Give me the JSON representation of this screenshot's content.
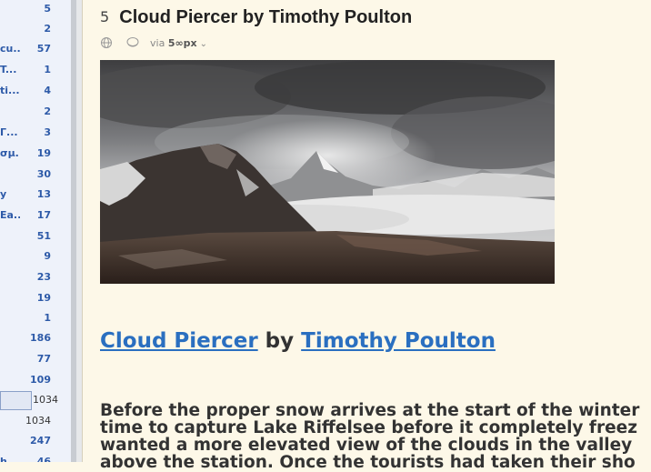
{
  "sidebar": {
    "feeds": [
      {
        "name": "",
        "count": "5"
      },
      {
        "name": "",
        "count": "2"
      },
      {
        "name": "cu...",
        "count": "57"
      },
      {
        "name": " T...",
        "count": "1"
      },
      {
        "name": "ti...",
        "count": "4"
      },
      {
        "name": "",
        "count": "2"
      },
      {
        "name": " Γ...",
        "count": "3"
      },
      {
        "name": "σμ...",
        "count": "19"
      },
      {
        "name": "",
        "count": "30"
      },
      {
        "name": "y",
        "count": "13"
      },
      {
        "name": "Ea...",
        "count": "17"
      },
      {
        "name": "",
        "count": "51"
      },
      {
        "name": "",
        "count": "9"
      },
      {
        "name": "",
        "count": "23"
      },
      {
        "name": "",
        "count": "19"
      },
      {
        "name": "",
        "count": "1"
      },
      {
        "name": "",
        "count": "186"
      },
      {
        "name": "",
        "count": "77"
      },
      {
        "name": "",
        "count": "109"
      },
      {
        "name": "",
        "count": "1034"
      },
      {
        "name": "",
        "count": "1034"
      },
      {
        "name": "",
        "count": "247"
      },
      {
        "name": "h",
        "count": "46"
      }
    ]
  },
  "story": {
    "feed_icon": "5",
    "title": "Cloud Piercer by Timothy Poulton",
    "via_label": "via",
    "source": "5∞px",
    "content_link_title": "Cloud Piercer",
    "content_by": " by ",
    "content_link_author": "Timothy Poulton",
    "body_lines": [
      "Before the proper snow arrives at the start of the winter",
      "time to capture Lake Riffelsee before it completely freez",
      "wanted a more elevated view of the clouds in the valley",
      "above the station. Once the tourists had taken their sho"
    ]
  },
  "icons": {
    "globe": "globe-icon",
    "feed": "feed-source-icon",
    "chevron": "chevron-down-icon"
  },
  "colors": {
    "link": "#2a6fc0",
    "sidebar_count": "#2d5aa8",
    "background": "#fdf8e8"
  }
}
